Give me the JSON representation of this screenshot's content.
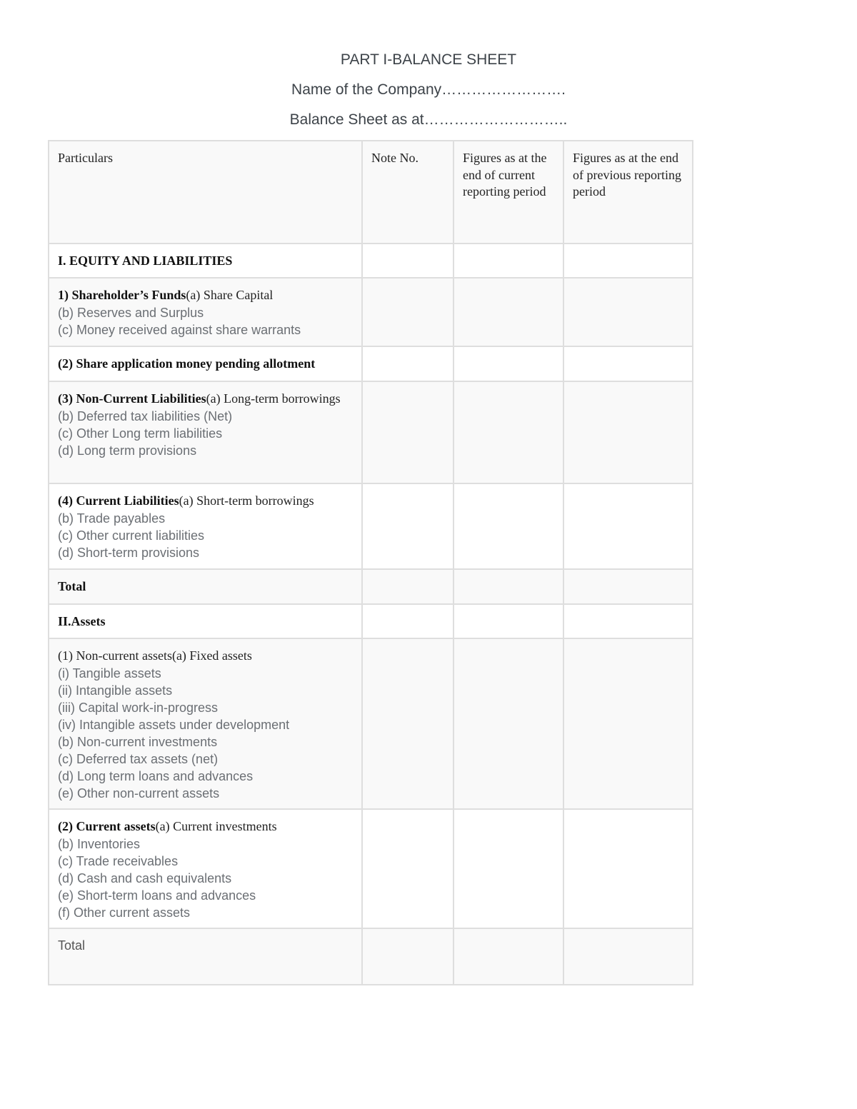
{
  "header": {
    "title": "PART I-BALANCE SHEET",
    "company_line": "Name of the Company…………………….",
    "date_line": "Balance Sheet as at……………………….."
  },
  "table": {
    "columns": [
      "Particulars",
      "Note No.",
      "Figures as at the end of current reporting period",
      "Figures as at the end of previous reporting period"
    ],
    "rows": [
      {
        "heading": "I. EQUITY AND LIABILITIES",
        "heading_bold": true,
        "lead": "",
        "items": []
      },
      {
        "heading": "1) Shareholder’s Funds",
        "heading_bold": true,
        "lead": "(a) Share Capital",
        "items": [
          "(b) Reserves and Surplus",
          "(c) Money received against share warrants"
        ]
      },
      {
        "heading": "(2) Share application money pending allotment",
        "heading_bold": true,
        "lead": "",
        "items": []
      },
      {
        "heading": "(3) Non-Current Liabilities",
        "heading_bold": true,
        "lead": "(a) Long-term borrowings",
        "items": [
          "(b) Deferred tax liabilities (Net)",
          "(c) Other Long term liabilities",
          "(d) Long term provisions"
        ]
      },
      {
        "heading": "(4) Current Liabilities",
        "heading_bold": true,
        "lead": "(a) Short-term borrowings",
        "items": [
          "(b) Trade payables",
          "(c) Other current liabilities",
          "(d) Short-term provisions"
        ]
      },
      {
        "heading": "Total",
        "heading_bold": true,
        "lead": "",
        "items": []
      },
      {
        "heading": "II.Assets",
        "heading_bold": true,
        "lead": "",
        "items": []
      },
      {
        "heading": "(1) Non-current assets",
        "heading_bold": false,
        "lead": "(a) Fixed assets",
        "items": [
          "(i) Tangible assets",
          "(ii) Intangible assets",
          "(iii) Capital work-in-progress",
          "(iv) Intangible assets under development",
          "(b) Non-current investments",
          "(c) Deferred tax assets (net)",
          "(d) Long term loans and advances",
          "(e) Other non-current assets"
        ]
      },
      {
        "heading": "(2) Current assets",
        "heading_bold": true,
        "lead": "(a) Current investments",
        "items": [
          "(b) Inventories",
          "(c) Trade receivables",
          "(d) Cash and cash equivalents",
          "(e) Short-term loans and advances",
          "(f) Other current assets"
        ]
      },
      {
        "heading": "Total",
        "heading_bold": false,
        "lead": "",
        "items": []
      }
    ],
    "note_values": [
      "",
      "",
      "",
      "",
      "",
      "",
      "",
      "",
      "",
      ""
    ],
    "current_values": [
      "",
      "",
      "",
      "",
      "",
      "",
      "",
      "",
      "",
      ""
    ],
    "previous_values": [
      "",
      "",
      "",
      "",
      "",
      "",
      "",
      "",
      "",
      ""
    ]
  }
}
